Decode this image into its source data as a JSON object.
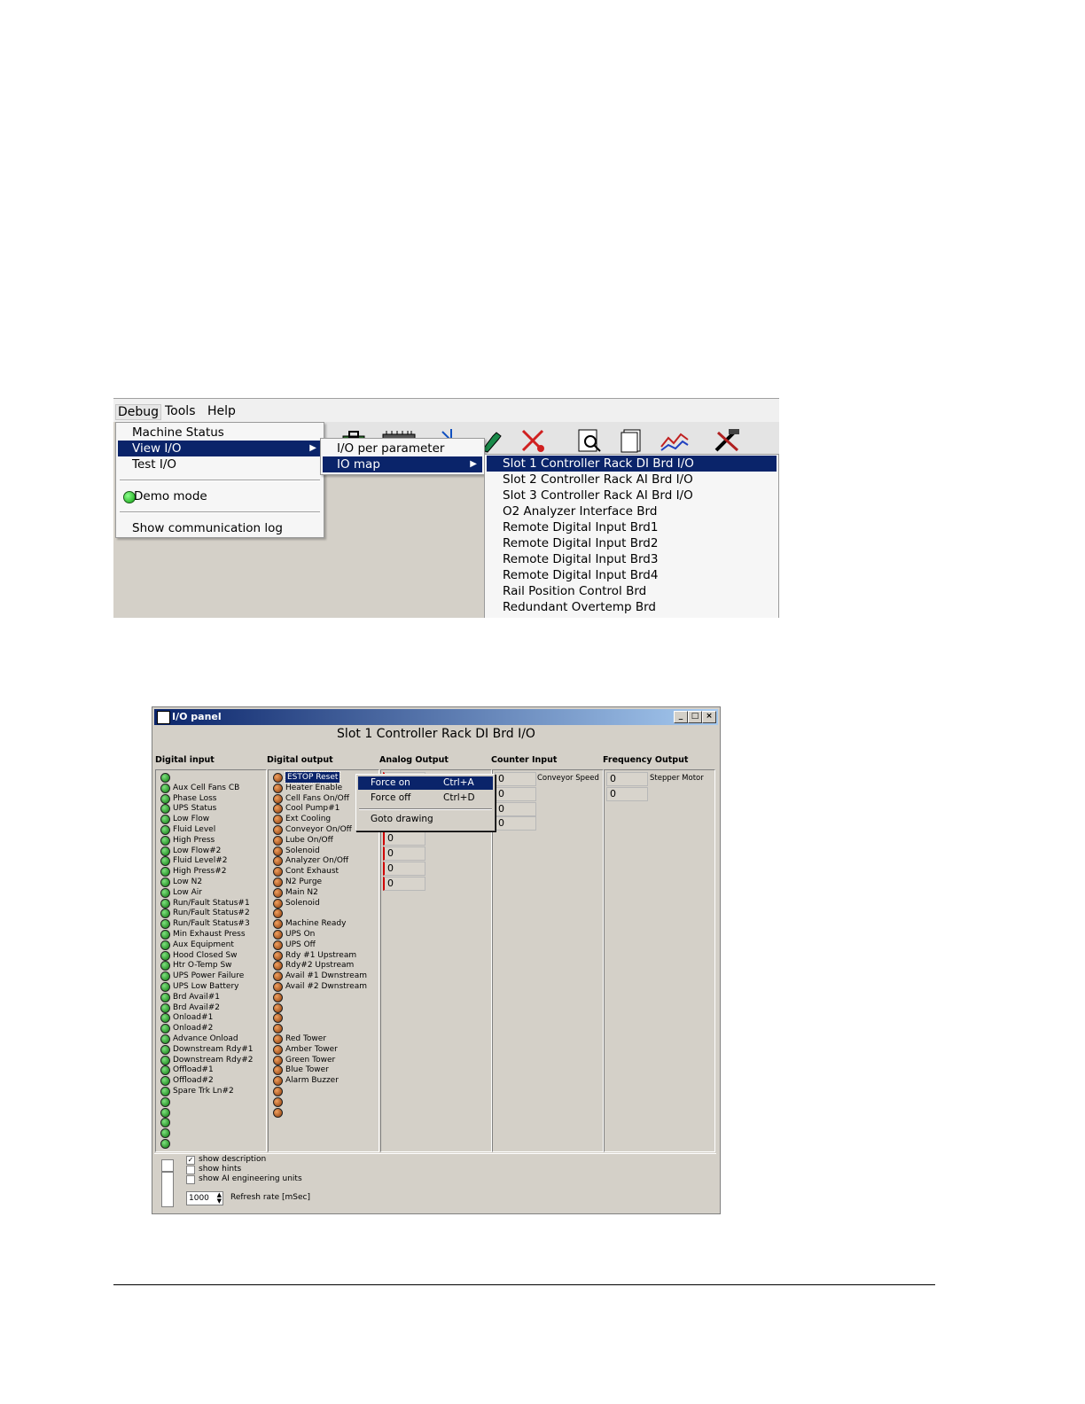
{
  "menubar": {
    "items": [
      {
        "label": "Debug",
        "mnemonic": "D"
      },
      {
        "label": "Tools",
        "mnemonic": "T"
      },
      {
        "label": "Help",
        "mnemonic": "H"
      }
    ]
  },
  "debug_menu": {
    "items": [
      "Machine Status",
      "View I/O",
      "Test I/O",
      "Demo mode",
      "Show communication log"
    ]
  },
  "view_io_menu": {
    "items": [
      "I/O per parameter",
      "IO map"
    ]
  },
  "io_map_menu": {
    "items": [
      "Slot 1 Controller Rack DI Brd I/O",
      "Slot 2 Controller Rack AI Brd I/O",
      "Slot 3 Controller Rack AI Brd I/O",
      "O2 Analyzer Interface Brd",
      "Remote Digital Input Brd1",
      "Remote Digital Input Brd2",
      "Remote Digital Input Brd3",
      "Remote Digital Input Brd4",
      "Rail Position Control Brd",
      "Redundant Overtemp Brd"
    ],
    "selected_index": 0
  },
  "toolbar": {
    "icons": [
      "briefcase-icon",
      "ribbon-cable-icon",
      "spinner-icon",
      "wrench-icon",
      "cross-tools-icon",
      "magnify-doc-icon",
      "pages-icon",
      "trend-chart-icon",
      "hammer-wrench-icon"
    ]
  },
  "io_panel": {
    "window_title": "I/O panel",
    "heading": "Slot 1 Controller Rack DI Brd I/O",
    "columns": {
      "digital_input": "Digital input",
      "digital_output": "Digital output",
      "analog_output": "Analog Output",
      "counter_input": "Counter Input",
      "frequency_output": "Frequency Output"
    },
    "digital_inputs": [
      "",
      "Aux Cell Fans CB",
      "Phase Loss",
      "UPS Status",
      "Low Flow",
      "Fluid Level",
      "High Press",
      "Low Flow#2",
      "Fluid Level#2",
      "High Press#2",
      "Low N2",
      "Low Air",
      "Run/Fault Status#1",
      "Run/Fault Status#2",
      "Run/Fault Status#3",
      "Min Exhaust Press",
      "Aux Equipment",
      "Hood Closed Sw",
      "Htr O-Temp Sw",
      "UPS Power Failure",
      "UPS Low Battery",
      "Brd Avail#1",
      "Brd Avail#2",
      "Onload#1",
      "Onload#2",
      "Advance Onload",
      "Downstream Rdy#1",
      "Downstream Rdy#2",
      "Offload#1",
      "Offload#2",
      "Spare Trk Ln#2",
      "",
      "",
      "",
      "",
      ""
    ],
    "digital_outputs": [
      "ESTOP Reset",
      "Heater Enable",
      "Cell Fans On/Off",
      "Cool Pump#1",
      "Ext Cooling",
      "Conveyor On/Off",
      "Lube On/Off",
      "Solenoid",
      "Analyzer On/Off",
      "Cont Exhaust",
      "N2 Purge",
      "Main N2",
      "Solenoid",
      "",
      "Machine Ready",
      "UPS On",
      "UPS Off",
      "Rdy #1 Upstream",
      "Rdy#2 Upstream",
      "Avail #1 Dwnstream",
      "Avail #2 Dwnstream",
      "",
      "",
      "",
      "",
      "Red Tower",
      "Amber Tower",
      "Green Tower",
      "Blue Tower",
      "Alarm Buzzer",
      "",
      "",
      ""
    ],
    "analog_outputs": [
      "0",
      "0",
      "0",
      "0",
      "0",
      "0",
      "0",
      "0"
    ],
    "counter_inputs": [
      "0",
      "0",
      "0",
      "0"
    ],
    "counter_label": "Conveyor Speed",
    "frequency_outputs": [
      "0",
      "0"
    ],
    "frequency_label": "Stepper Motor",
    "context_menu": {
      "items": [
        {
          "label": "Force on",
          "shortcut": "Ctrl+A"
        },
        {
          "label": "Force off",
          "shortcut": "Ctrl+D"
        },
        {
          "label": "Goto drawing",
          "shortcut": ""
        }
      ],
      "selected_index": 0
    },
    "options": {
      "show_description": "show description",
      "show_description_checked": true,
      "show_hints": "show hints",
      "show_hints_checked": false,
      "show_ai_units": "show AI engineering units",
      "show_ai_units_checked": false,
      "refresh_value": "1000",
      "refresh_label": "Refresh rate [mSec]"
    }
  }
}
